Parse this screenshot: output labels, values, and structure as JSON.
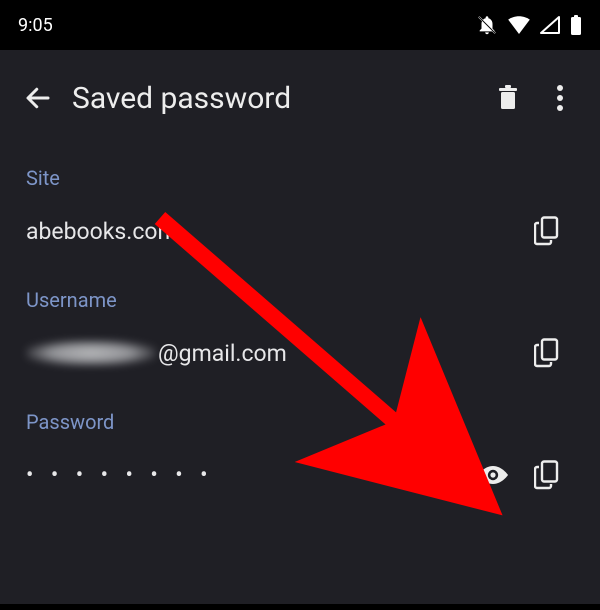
{
  "status": {
    "time": "9:05"
  },
  "header": {
    "title": "Saved password"
  },
  "fields": {
    "site": {
      "label": "Site",
      "value": "abebooks.com"
    },
    "username": {
      "label": "Username",
      "value_visible": "@gmail.com"
    },
    "password": {
      "label": "Password",
      "masked": "• • • • • • • •"
    }
  }
}
